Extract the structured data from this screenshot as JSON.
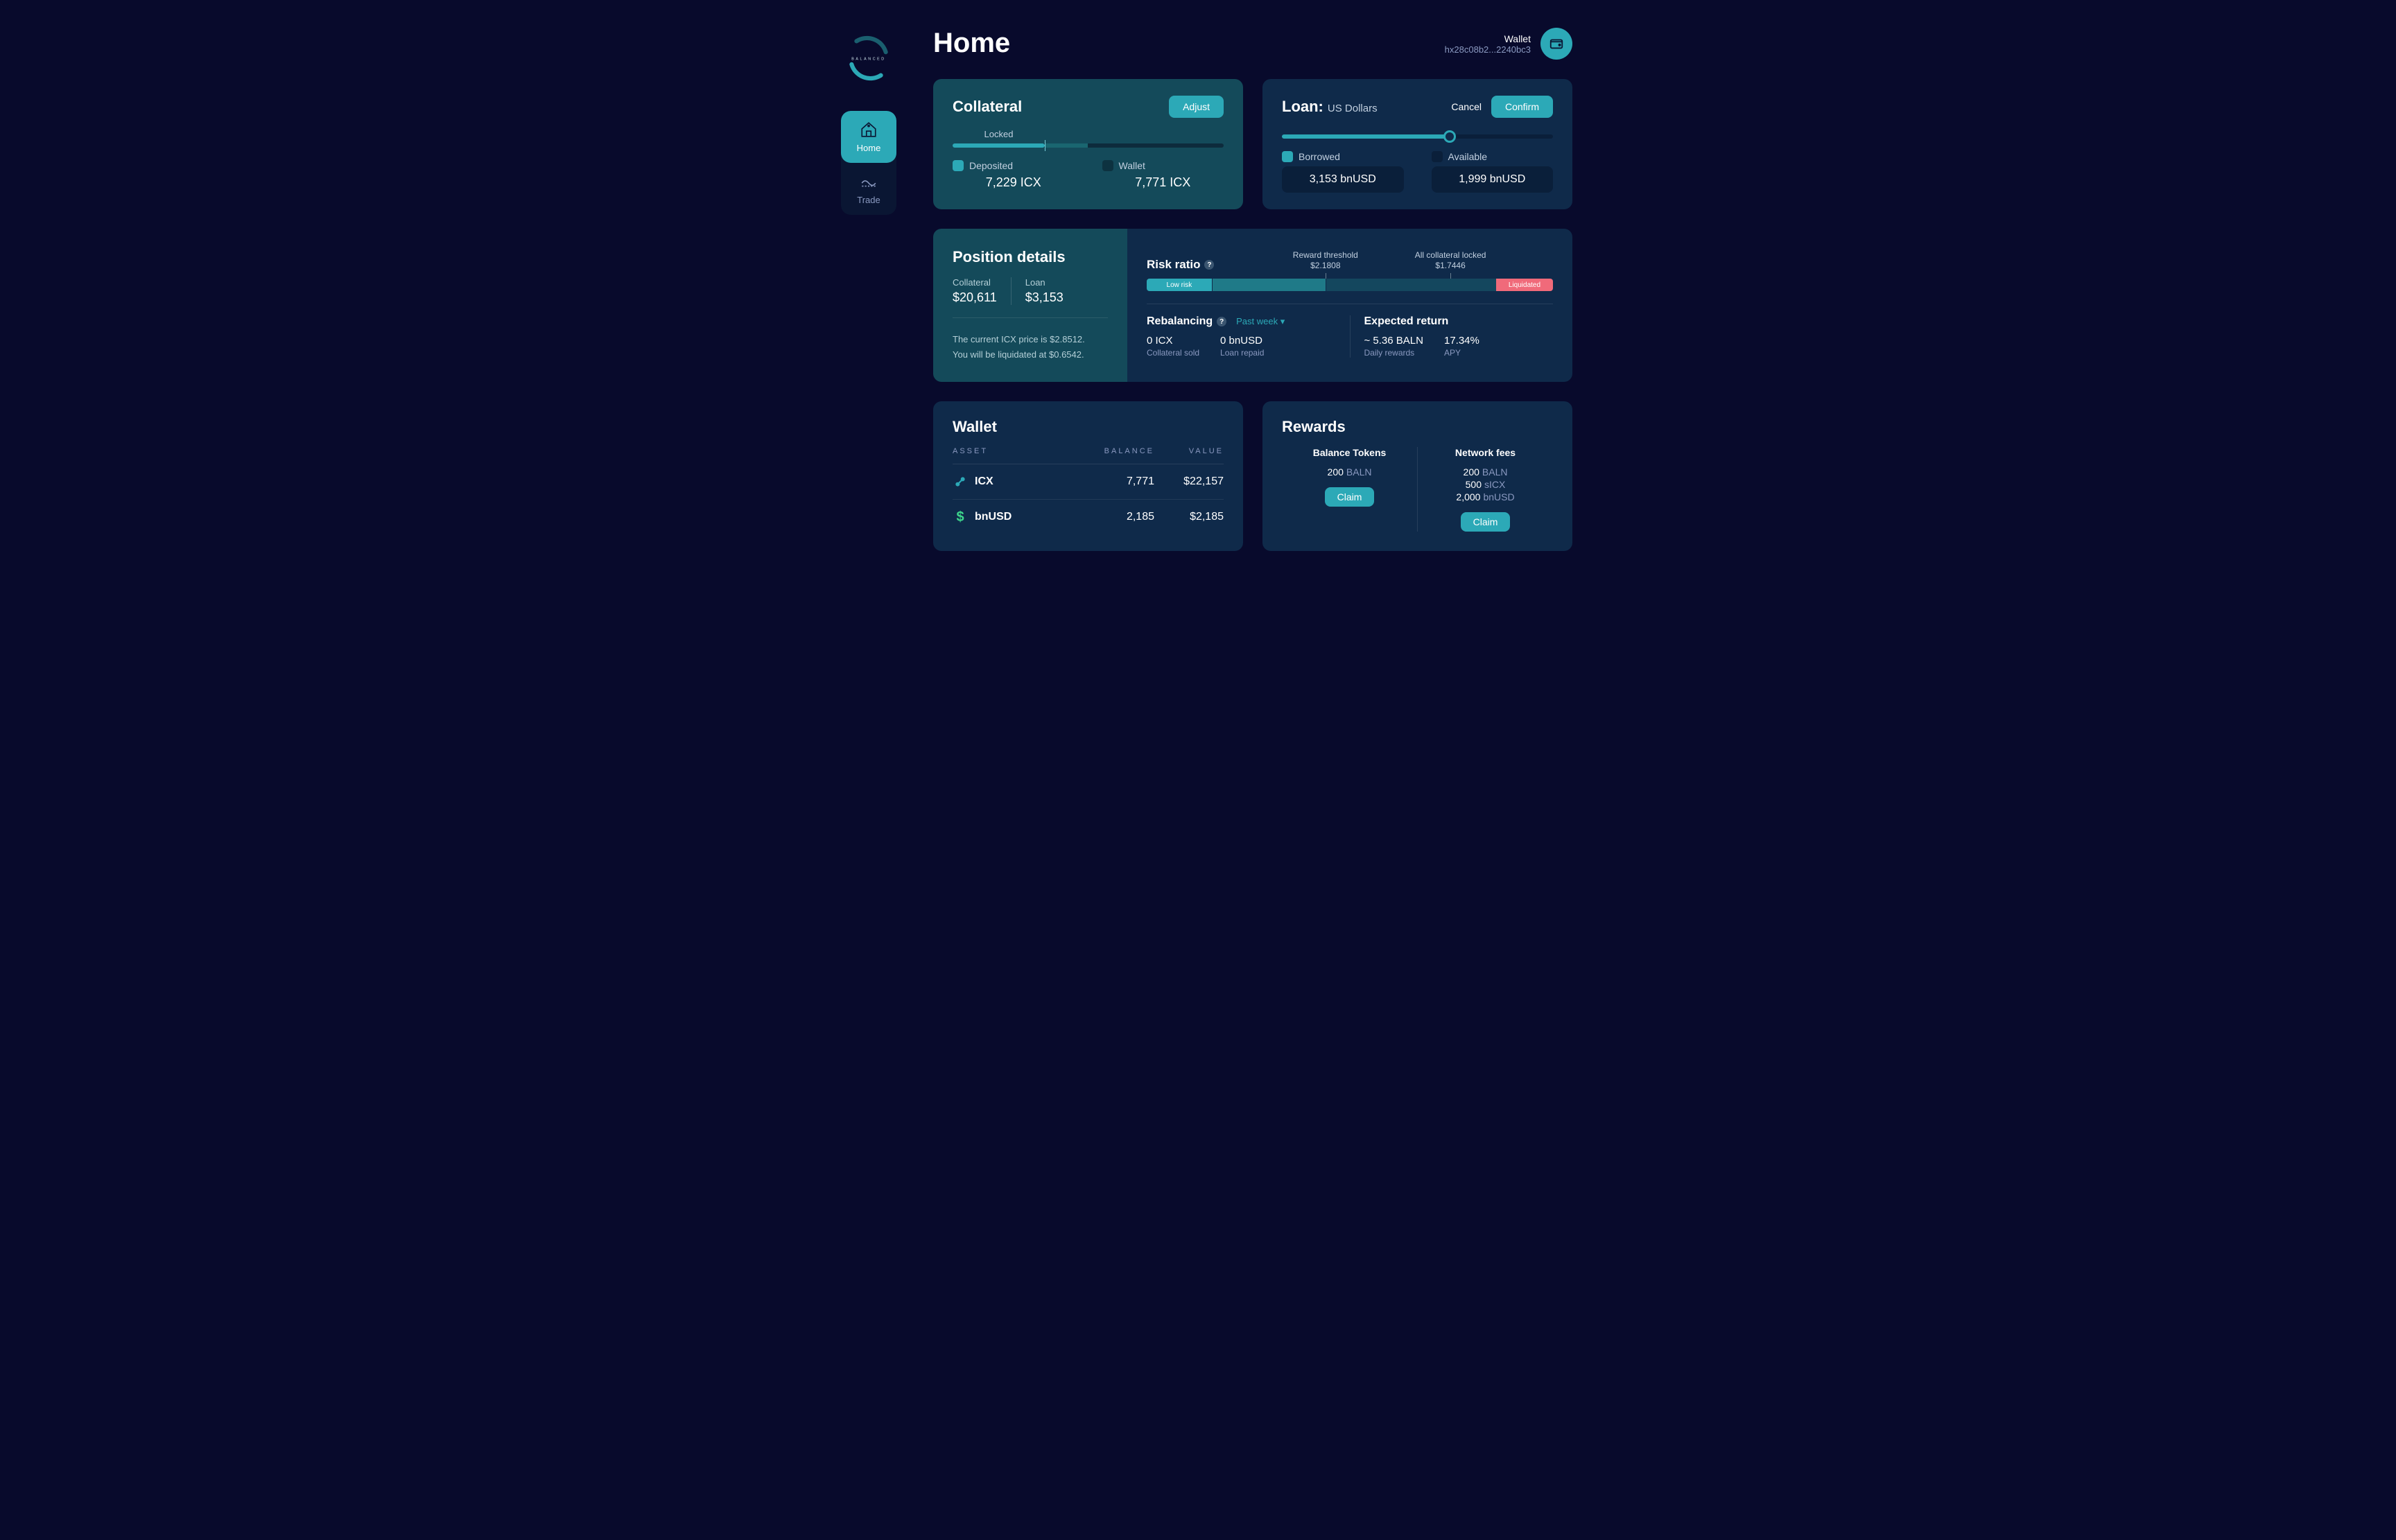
{
  "brand": "BALANCED",
  "page_title": "Home",
  "wallet_header": {
    "label": "Wallet",
    "address": "hx28c08b2...2240bc3"
  },
  "nav": {
    "home": "Home",
    "trade": "Trade"
  },
  "collateral": {
    "title": "Collateral",
    "adjust": "Adjust",
    "locked_label": "Locked",
    "deposited_label": "Deposited",
    "deposited_value": "7,229 ICX",
    "wallet_label": "Wallet",
    "wallet_value": "7,771 ICX"
  },
  "loan": {
    "title": "Loan:",
    "subtitle": "US Dollars",
    "cancel": "Cancel",
    "confirm": "Confirm",
    "borrowed_label": "Borrowed",
    "borrowed_value": "3,153 bnUSD",
    "available_label": "Available",
    "available_value": "1,999 bnUSD"
  },
  "position": {
    "title": "Position details",
    "collateral_label": "Collateral",
    "collateral_value": "$20,611",
    "loan_label": "Loan",
    "loan_value": "$3,153",
    "note1": "The current ICX price is $2.8512.",
    "note2": "You will be liquidated at $0.6542.",
    "risk_title": "Risk ratio",
    "reward_threshold_label": "Reward threshold",
    "reward_threshold_value": "$2.1808",
    "locked_label": "All collateral locked",
    "locked_value": "$1.7446",
    "low_risk": "Low risk",
    "liquidated": "Liquidated",
    "rebal_title": "Rebalancing",
    "rebal_period": "Past week",
    "rebal_icx": "0 ICX",
    "rebal_icx_label": "Collateral sold",
    "rebal_bnusd": "0 bnUSD",
    "rebal_bnusd_label": "Loan repaid",
    "expret_title": "Expected return",
    "expret_baln": "~ 5.36 BALN",
    "expret_baln_label": "Daily rewards",
    "expret_apy": "17.34%",
    "expret_apy_label": "APY"
  },
  "wallet_card": {
    "title": "Wallet",
    "h_asset": "ASSET",
    "h_balance": "BALANCE",
    "h_value": "VALUE",
    "rows": [
      {
        "asset": "ICX",
        "balance": "7,771",
        "value": "$22,157"
      },
      {
        "asset": "bnUSD",
        "balance": "2,185",
        "value": "$2,185"
      }
    ]
  },
  "rewards": {
    "title": "Rewards",
    "tokens_title": "Balance Tokens",
    "tokens_amount": "200",
    "tokens_unit": "BALN",
    "fees_title": "Network fees",
    "fees": [
      {
        "amount": "200",
        "unit": "BALN"
      },
      {
        "amount": "500",
        "unit": "sICX"
      },
      {
        "amount": "2,000",
        "unit": "bnUSD"
      }
    ],
    "claim": "Claim"
  }
}
